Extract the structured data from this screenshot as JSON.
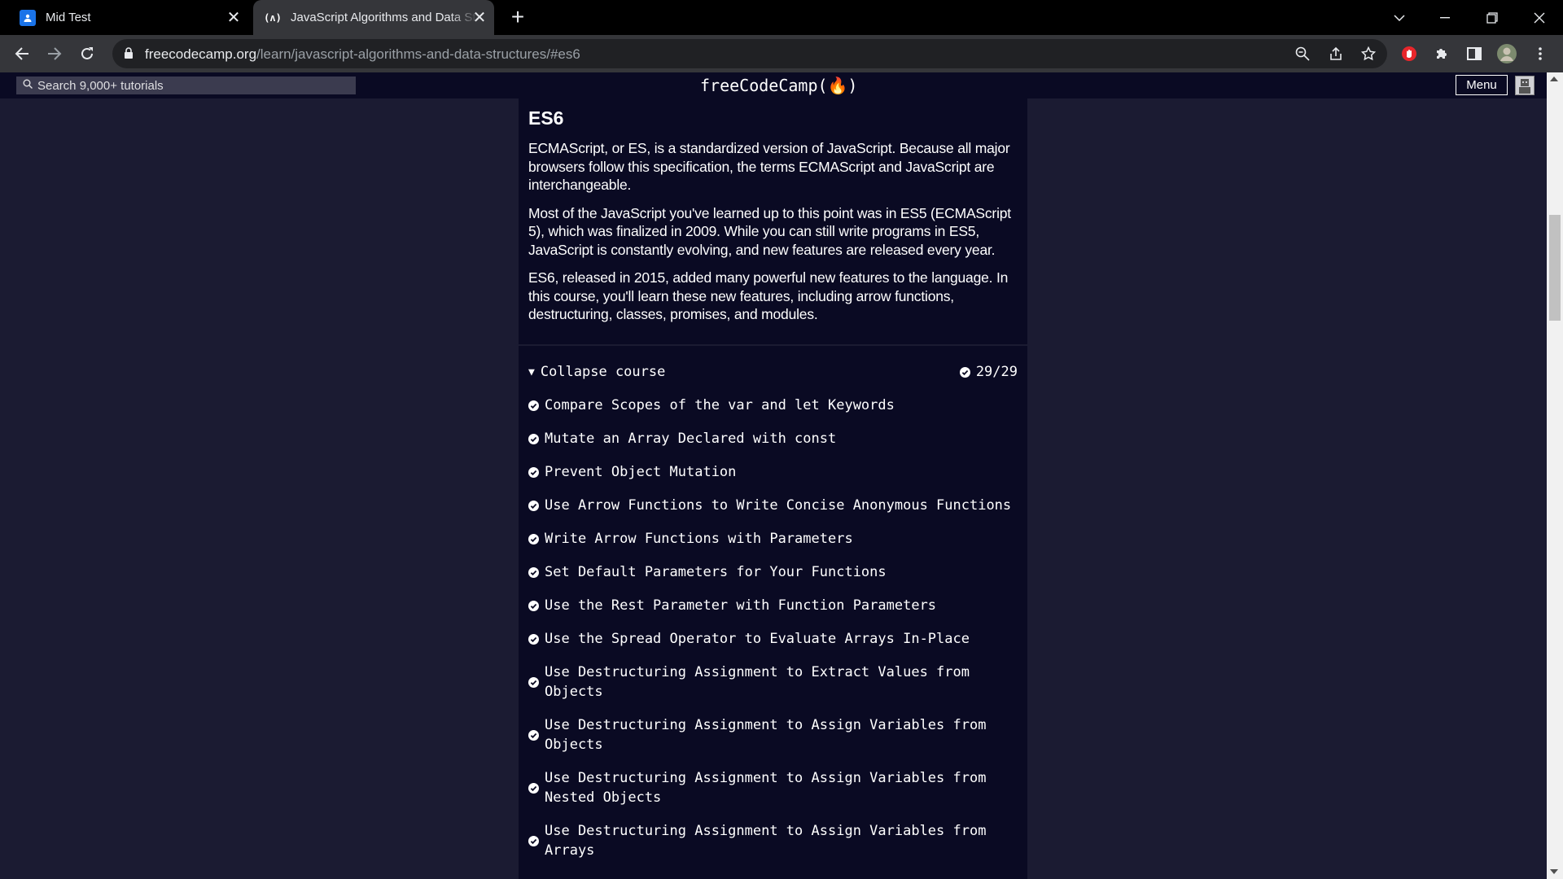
{
  "browser": {
    "tabs": [
      {
        "title": "Mid Test",
        "icon": "google-classroom-icon"
      },
      {
        "title": "JavaScript Algorithms and Data Structures",
        "icon": "freecodecamp-icon"
      }
    ],
    "url": {
      "host": "freecodecamp.org",
      "path": "/learn/javascript-algorithms-and-data-structures/#es6"
    }
  },
  "fcc_nav": {
    "search_placeholder": "Search 9,000+ tutorials",
    "logo": "freeCodeCamp(🔥)",
    "menu_label": "Menu"
  },
  "section": {
    "title": "ES6",
    "paragraphs": [
      "ECMAScript, or ES, is a standardized version of JavaScript. Because all major browsers follow this specification, the terms ECMAScript and JavaScript are interchangeable.",
      "Most of the JavaScript you've learned up to this point was in ES5 (ECMAScript 5), which was finalized in 2009. While you can still write programs in ES5, JavaScript is constantly evolving, and new features are released every year.",
      "ES6, released in 2015, added many powerful new features to the language. In this course, you'll learn these new features, including arrow functions, destructuring, classes, promises, and modules."
    ],
    "collapse_label": "Collapse course",
    "progress": "29/29",
    "lessons": [
      "Compare Scopes of the var and let Keywords",
      "Mutate an Array Declared with const",
      "Prevent Object Mutation",
      "Use Arrow Functions to Write Concise Anonymous Functions",
      "Write Arrow Functions with Parameters",
      "Set Default Parameters for Your Functions",
      "Use the Rest Parameter with Function Parameters",
      "Use the Spread Operator to Evaluate Arrays In-Place",
      "Use Destructuring Assignment to Extract Values from Objects",
      "Use Destructuring Assignment to Assign Variables from Objects",
      "Use Destructuring Assignment to Assign Variables from Nested Objects",
      "Use Destructuring Assignment to Assign Variables from Arrays"
    ]
  },
  "colors": {
    "page_bg": "#1b1b32",
    "panel_bg": "#0a0a23",
    "text": "#ffffff",
    "chrome_bg": "#35363a"
  }
}
